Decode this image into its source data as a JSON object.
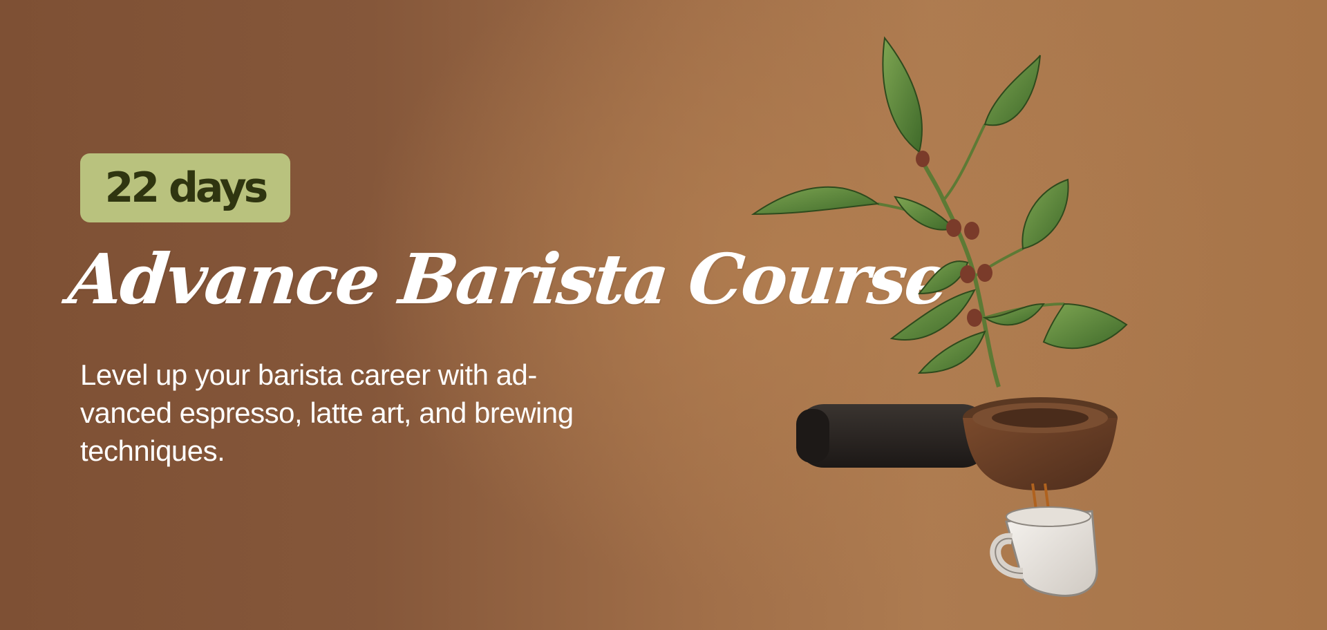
{
  "hero": {
    "badge_label": "22 days",
    "title": "Advance Barista Course",
    "subtitle": "Level up your barista career with ad-\nvanced espresso, latte art, and brewing techniques."
  },
  "colors": {
    "background_left": "#7e5034",
    "background_right": "#ad7b50",
    "badge_bg": "#b9c27e",
    "badge_text": "#2f3510",
    "leaf": "#5f8a3a",
    "bean": "#7a3b2a",
    "portafilter_handle": "#2a2522",
    "cup": "#ece8e2"
  },
  "icons": [
    "coffee-plant-illustration",
    "portafilter-illustration",
    "espresso-cup-illustration"
  ]
}
